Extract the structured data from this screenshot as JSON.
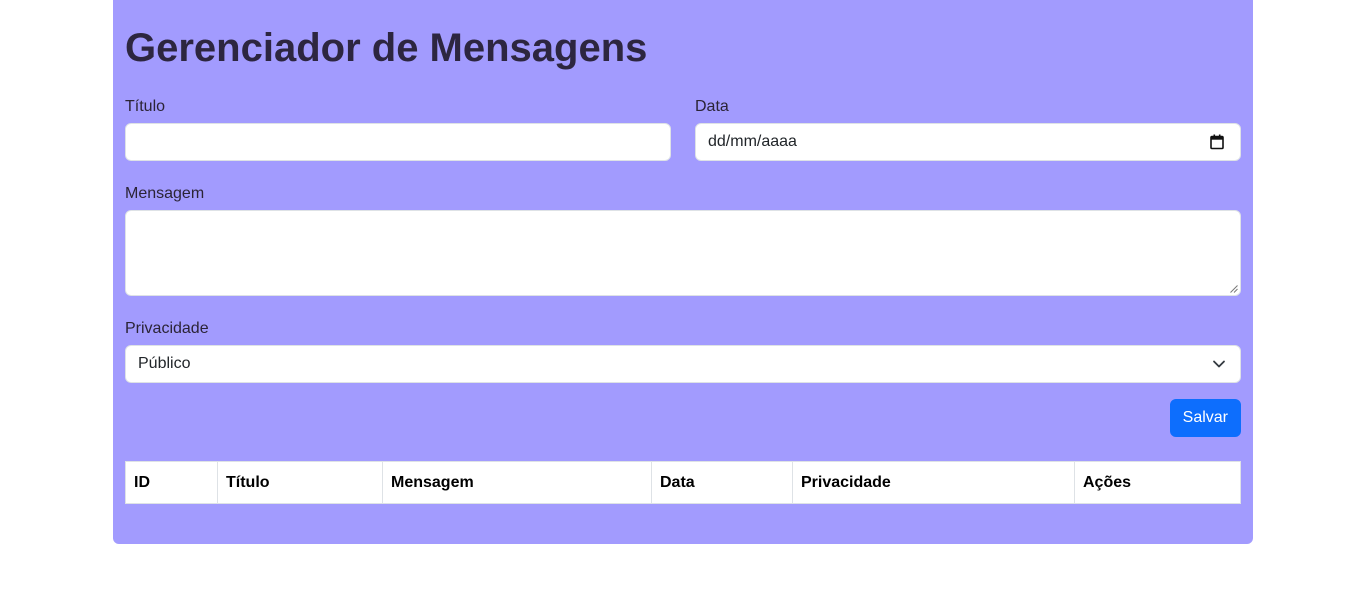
{
  "page": {
    "title": "Gerenciador de Mensagens",
    "background_color": "#a29bfe"
  },
  "form": {
    "titulo": {
      "label": "Título",
      "value": ""
    },
    "data": {
      "label": "Data",
      "placeholder": "dd/mm/aaaa"
    },
    "mensagem": {
      "label": "Mensagem",
      "value": ""
    },
    "privacidade": {
      "label": "Privacidade",
      "selected": "Público"
    },
    "save_button": {
      "label": "Salvar",
      "color": "#0d6efd"
    }
  },
  "table": {
    "columns": [
      "ID",
      "Título",
      "Mensagem",
      "Data",
      "Privacidade",
      "Ações"
    ],
    "rows": []
  },
  "icons": {
    "date_picker": "calendar-icon",
    "select_arrow": "chevron-down-icon"
  }
}
